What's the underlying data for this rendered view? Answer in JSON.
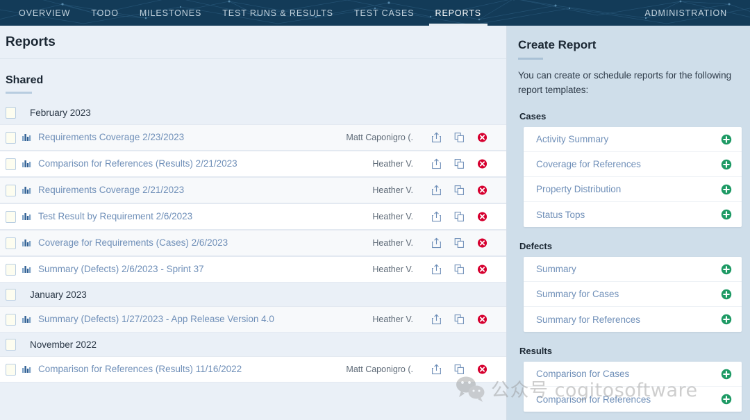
{
  "nav": {
    "left_items": [
      {
        "label": "OVERVIEW",
        "active": false
      },
      {
        "label": "TODO",
        "active": false
      },
      {
        "label": "MILESTONES",
        "active": false
      },
      {
        "label": "TEST RUNS & RESULTS",
        "active": false
      },
      {
        "label": "TEST CASES",
        "active": false
      },
      {
        "label": "REPORTS",
        "active": true
      }
    ],
    "right_items": [
      {
        "label": "ADMINISTRATION",
        "active": false
      }
    ],
    "background_color": "#133b58",
    "active_color": "#ffffff",
    "inactive_color": "#c3d3de"
  },
  "left_pane": {
    "page_title": "Reports",
    "section_title": "Shared",
    "link_color": "#6f8fb8",
    "rows": [
      {
        "kind": "group",
        "label": "February 2023"
      },
      {
        "kind": "report",
        "name": "Requirements Coverage 2/23/2023",
        "owner": "Matt Caponigro (.",
        "alt": true
      },
      {
        "kind": "report",
        "name": "Comparison for References (Results) 2/21/2023",
        "owner": "Heather V.",
        "alt": false
      },
      {
        "kind": "report",
        "name": "Requirements Coverage 2/21/2023",
        "owner": "Heather V.",
        "alt": true
      },
      {
        "kind": "report",
        "name": "Test Result by Requirement 2/6/2023",
        "owner": "Heather V.",
        "alt": false
      },
      {
        "kind": "report",
        "name": "Coverage for Requirements (Cases) 2/6/2023",
        "owner": "Heather V.",
        "alt": true
      },
      {
        "kind": "report",
        "name": "Summary (Defects) 2/6/2023 - Sprint 37",
        "owner": "Heather V.",
        "alt": false
      },
      {
        "kind": "group",
        "label": "January 2023"
      },
      {
        "kind": "report",
        "name": "Summary (Defects) 1/27/2023 - App Release Version 4.0",
        "owner": "Heather V.",
        "alt": true
      },
      {
        "kind": "group",
        "label": "November 2022"
      },
      {
        "kind": "report",
        "name": "Comparison for References (Results) 11/16/2022",
        "owner": "Matt Caponigro (.",
        "alt": false
      }
    ],
    "row_actions": [
      {
        "icon": "share-export-icon",
        "label": "Share"
      },
      {
        "icon": "duplicate-icon",
        "label": "Duplicate"
      },
      {
        "icon": "delete-icon",
        "label": "Delete"
      }
    ]
  },
  "right_pane": {
    "title": "Create Report",
    "description": "You can create or schedule reports for the following report templates:",
    "accent_green": "#1d9a64",
    "background_color": "#cfdeea",
    "categories": [
      {
        "label": "Cases",
        "templates": [
          "Activity Summary",
          "Coverage for References",
          "Property Distribution",
          "Status Tops"
        ]
      },
      {
        "label": "Defects",
        "templates": [
          "Summary",
          "Summary for Cases",
          "Summary for References"
        ]
      },
      {
        "label": "Results",
        "templates": [
          "Comparison for Cases",
          "Comparison for References"
        ]
      }
    ]
  },
  "watermark": {
    "text": "公众号 cogitosoftware",
    "color": "#8d8d8d"
  }
}
